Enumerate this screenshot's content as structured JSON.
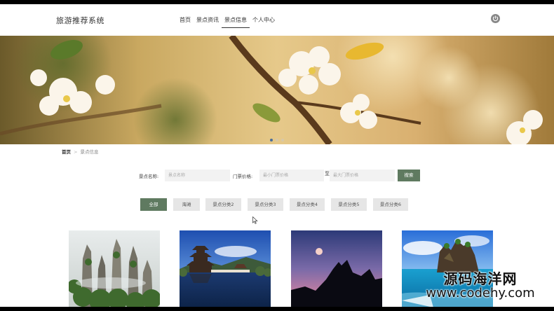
{
  "header": {
    "logo": "旅游推荐系统",
    "nav": [
      {
        "label": "首页",
        "active": false
      },
      {
        "label": "景点资讯",
        "active": false
      },
      {
        "label": "景点信息",
        "active": true
      },
      {
        "label": "个人中心",
        "active": false
      }
    ],
    "user_icon": "power-icon"
  },
  "banner": {
    "image": "apple-blossom-branch"
  },
  "breadcrumb": {
    "home": "首页",
    "separator": ">",
    "current": "景点信息"
  },
  "search": {
    "name_label": "景点名称:",
    "name_placeholder": "景点名称",
    "price_label": "门票价格:",
    "min_placeholder": "最小门票价格",
    "range_to": "至",
    "max_placeholder": "最大门票价格",
    "button": "搜索"
  },
  "categories": [
    {
      "label": "全部",
      "active": true
    },
    {
      "label": "海滩",
      "active": false
    },
    {
      "label": "景点分类2",
      "active": false
    },
    {
      "label": "景点分类3",
      "active": false
    },
    {
      "label": "景点分类4",
      "active": false
    },
    {
      "label": "景点分类5",
      "active": false
    },
    {
      "label": "景点分类6",
      "active": false
    }
  ],
  "cards": [
    {
      "image": "karst-pillar-mountains"
    },
    {
      "image": "pagoda-lake"
    },
    {
      "image": "sunset-mountain-silhouette"
    },
    {
      "image": "sea-rock-island"
    }
  ],
  "watermark": {
    "line1": "源码海洋网",
    "line2": "www.codehy.com"
  },
  "colors": {
    "accent": "#5f7a60",
    "chip_bg": "#e6e6e6"
  }
}
